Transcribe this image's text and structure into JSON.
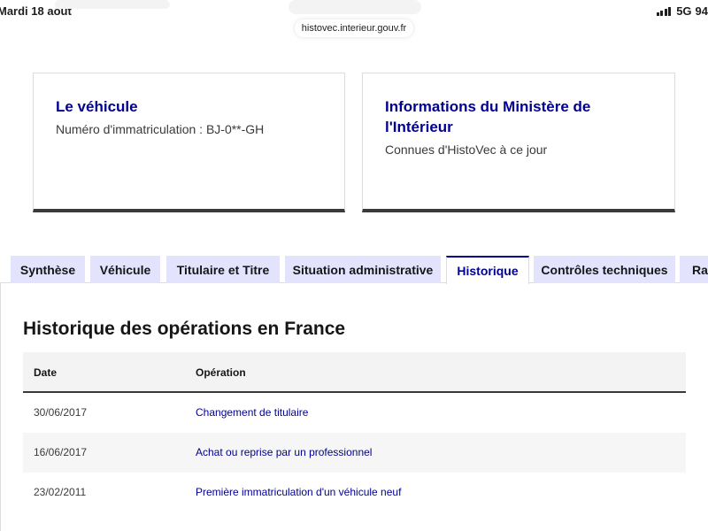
{
  "status_bar": {
    "date": "Mardi 18 août",
    "network": "5G",
    "battery": "94"
  },
  "browser": {
    "url": "histovec.interieur.gouv.fr"
  },
  "cards": [
    {
      "title": "Le véhicule",
      "subtitle": "Numéro d'immatriculation : BJ-0**-GH"
    },
    {
      "title": "Informations du Ministère de l'Intérieur",
      "subtitle": "Connues d'HistoVec à ce jour"
    }
  ],
  "tabs": [
    {
      "label": "Synthèse"
    },
    {
      "label": "Véhicule"
    },
    {
      "label": "Titulaire et Titre"
    },
    {
      "label": "Situation administrative"
    },
    {
      "label": "Historique",
      "active": true
    },
    {
      "label": "Contrôles techniques"
    },
    {
      "label": "Rap"
    }
  ],
  "history": {
    "title": "Historique des opérations en France",
    "columns": [
      "Date",
      "Opération"
    ],
    "rows": [
      {
        "date": "30/06/2017",
        "operation": "Changement de titulaire"
      },
      {
        "date": "16/06/2017",
        "operation": "Achat ou reprise par un professionnel"
      },
      {
        "date": "23/02/2011",
        "operation": "Première immatriculation d'un véhicule neuf"
      }
    ]
  },
  "colors": {
    "accent": "#000091",
    "tab_background": "#e3e3fd",
    "table_header": "#f3f3f3"
  }
}
